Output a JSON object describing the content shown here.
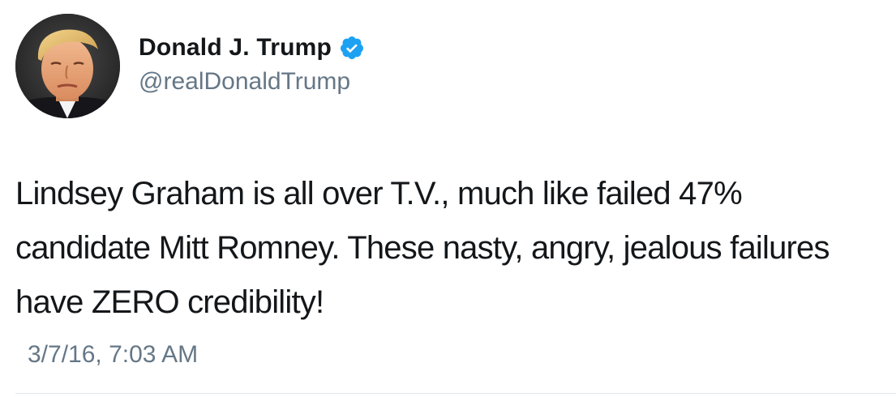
{
  "tweet": {
    "author": {
      "display_name": "Donald J. Trump",
      "handle": "@realDonaldTrump",
      "verified": true,
      "avatar": "profile-photo"
    },
    "text": "Lindsey Graham is all over T.V., much like failed 47% candidate Mitt Romney. These nasty, angry, jealous failures have ZERO credibility!",
    "timestamp": "3/7/16, 7:03 AM"
  },
  "colors": {
    "text_primary": "#14171a",
    "text_secondary": "#657786",
    "verified_badge": "#1da1f2",
    "divider": "#e1e8ed"
  }
}
